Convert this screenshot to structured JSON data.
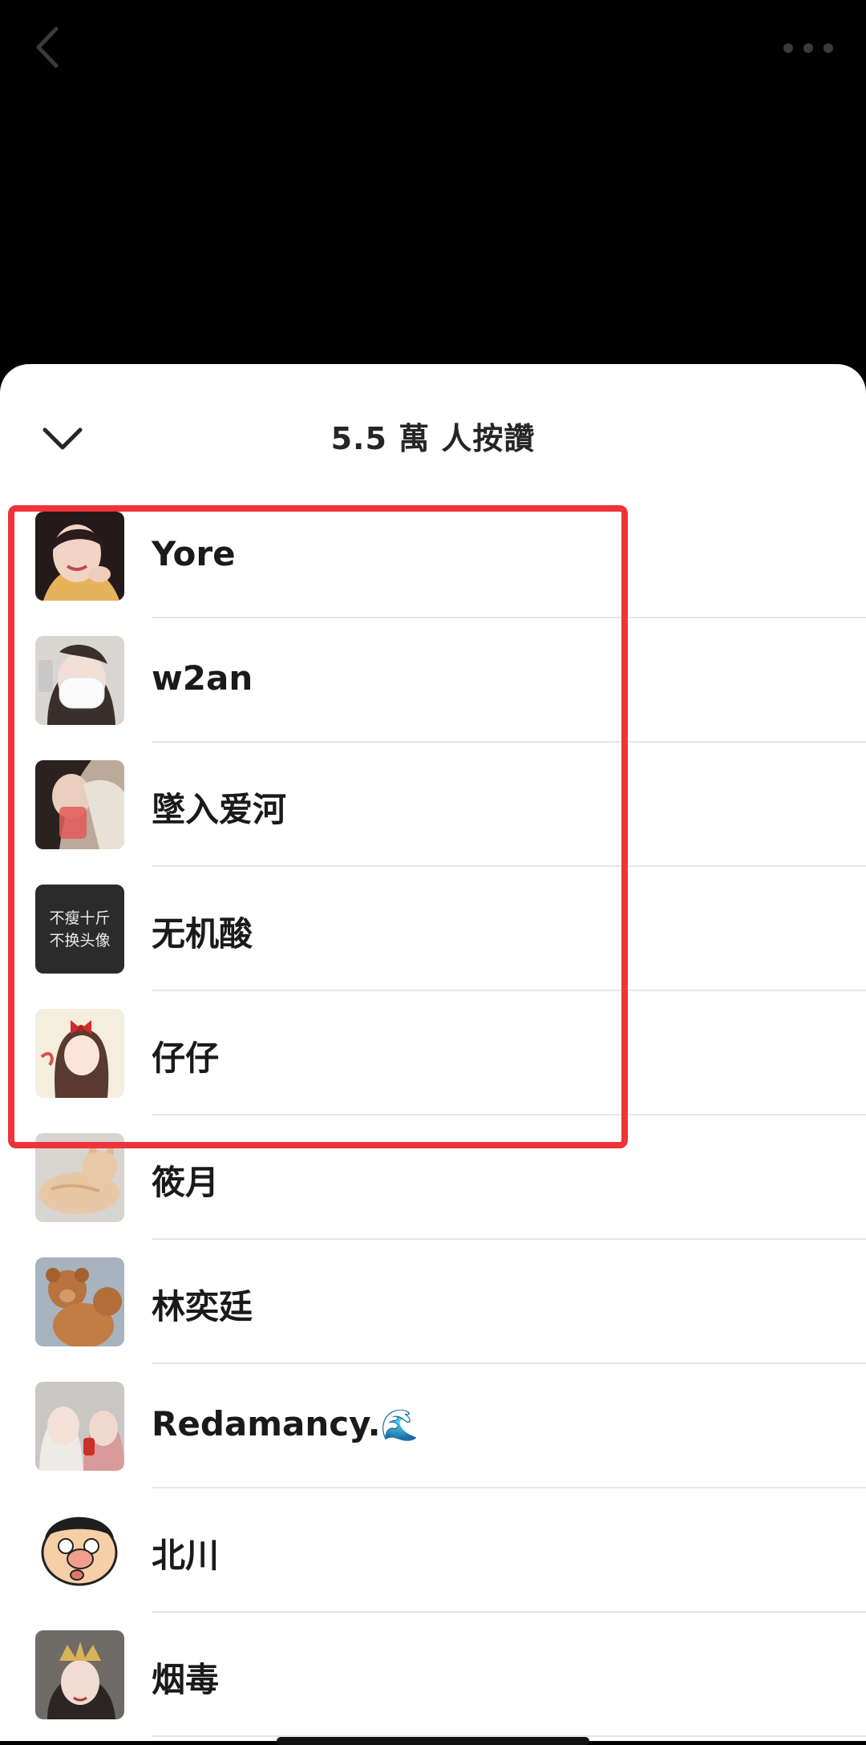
{
  "topbar": {
    "back_icon": "chevron-left-icon",
    "more_icon": "more-horizontal-icon"
  },
  "sheet": {
    "collapse_icon": "chevron-down-icon",
    "title": "5.5 萬 人按讚"
  },
  "likers": [
    {
      "name": "Yore",
      "avatar": "portrait-photo"
    },
    {
      "name": "w2an",
      "avatar": "portrait-photo"
    },
    {
      "name": "墜入爱河",
      "avatar": "portrait-photo"
    },
    {
      "name": "无机酸",
      "avatar": "text-avatar",
      "avatar_text": [
        "不瘦十斤",
        "不换头像"
      ]
    },
    {
      "name": "仔仔",
      "avatar": "illustration"
    },
    {
      "name": "筱月",
      "avatar": "cat-photo"
    },
    {
      "name": "林奕廷",
      "avatar": "teddy-bear-photo"
    },
    {
      "name": "Redamancy.",
      "name_suffix": "🌊",
      "avatar": "portrait-photo"
    },
    {
      "name": "北川",
      "avatar": "cartoon"
    },
    {
      "name": "烟毒",
      "avatar": "portrait-photo"
    }
  ],
  "highlight": {
    "color": "#ef333a",
    "covers_rows": [
      0,
      4
    ]
  },
  "colors": {
    "sheet_bg": "#ffffff",
    "backdrop": "#000000",
    "text": "#262626"
  }
}
